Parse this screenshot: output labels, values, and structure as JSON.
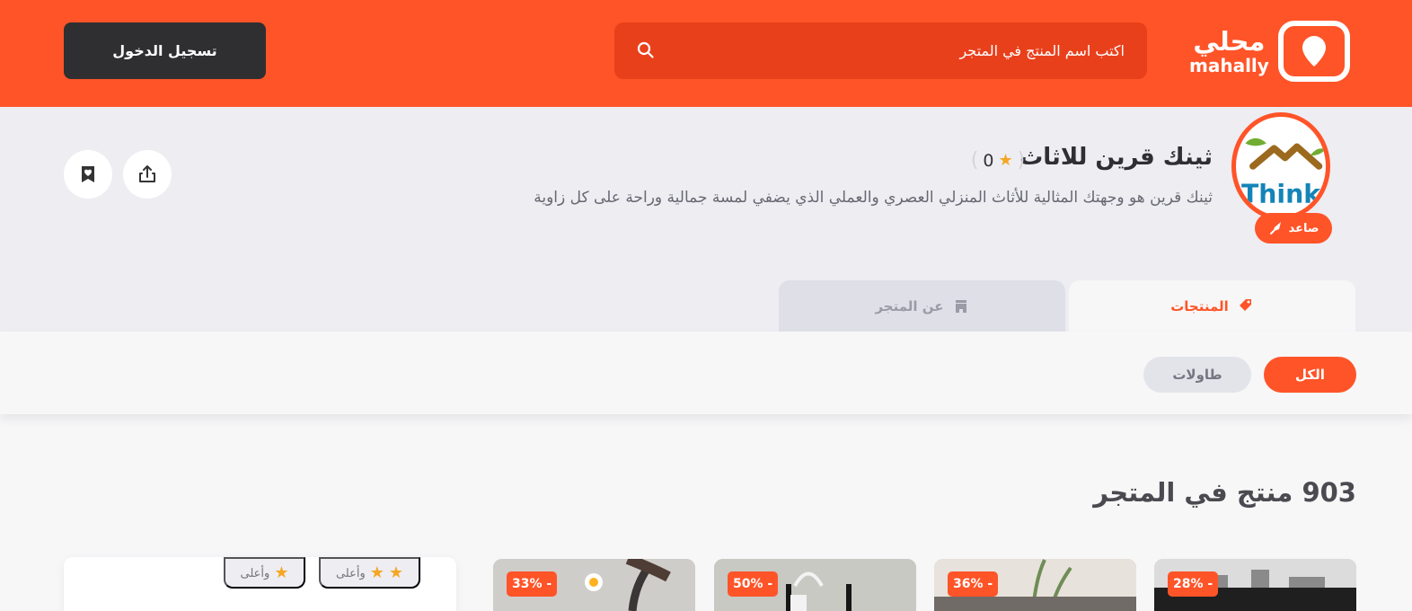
{
  "brand": {
    "arabic_name": "محلي",
    "latin_name": "mahally",
    "accent_color": "#ff5428",
    "dark_button_color": "#2f2f32"
  },
  "header": {
    "search_placeholder": "اكتب اسم المنتج في المتجر",
    "login_label": "تسجيل الدخول"
  },
  "store": {
    "name": "ثينك قرين للاثاث",
    "rating": "0",
    "description": "ثينك قرين هو وجهتك المثالية للأثاث المنزلي العصري والعملي الذي يضفي لمسة جمالية وراحة على كل زاوية",
    "logo_text": "Think",
    "badge": "صاعد"
  },
  "tabs": [
    {
      "label": "المنتجات",
      "icon": "tag-icon",
      "active": true
    },
    {
      "label": "عن المتجر",
      "icon": "store-icon",
      "active": false
    }
  ],
  "filters": [
    {
      "label": "الكل",
      "active": true
    },
    {
      "label": "طاولات",
      "active": false
    }
  ],
  "product_count": "903 منتج في المتجر",
  "rating_filters": [
    {
      "label": "وأعلى",
      "stars": 2
    },
    {
      "label": "وأعلى",
      "stars": 1
    }
  ],
  "products": [
    {
      "discount": "28% -"
    },
    {
      "discount": "36% -"
    },
    {
      "discount": "50% -"
    },
    {
      "discount": "33% -"
    }
  ]
}
